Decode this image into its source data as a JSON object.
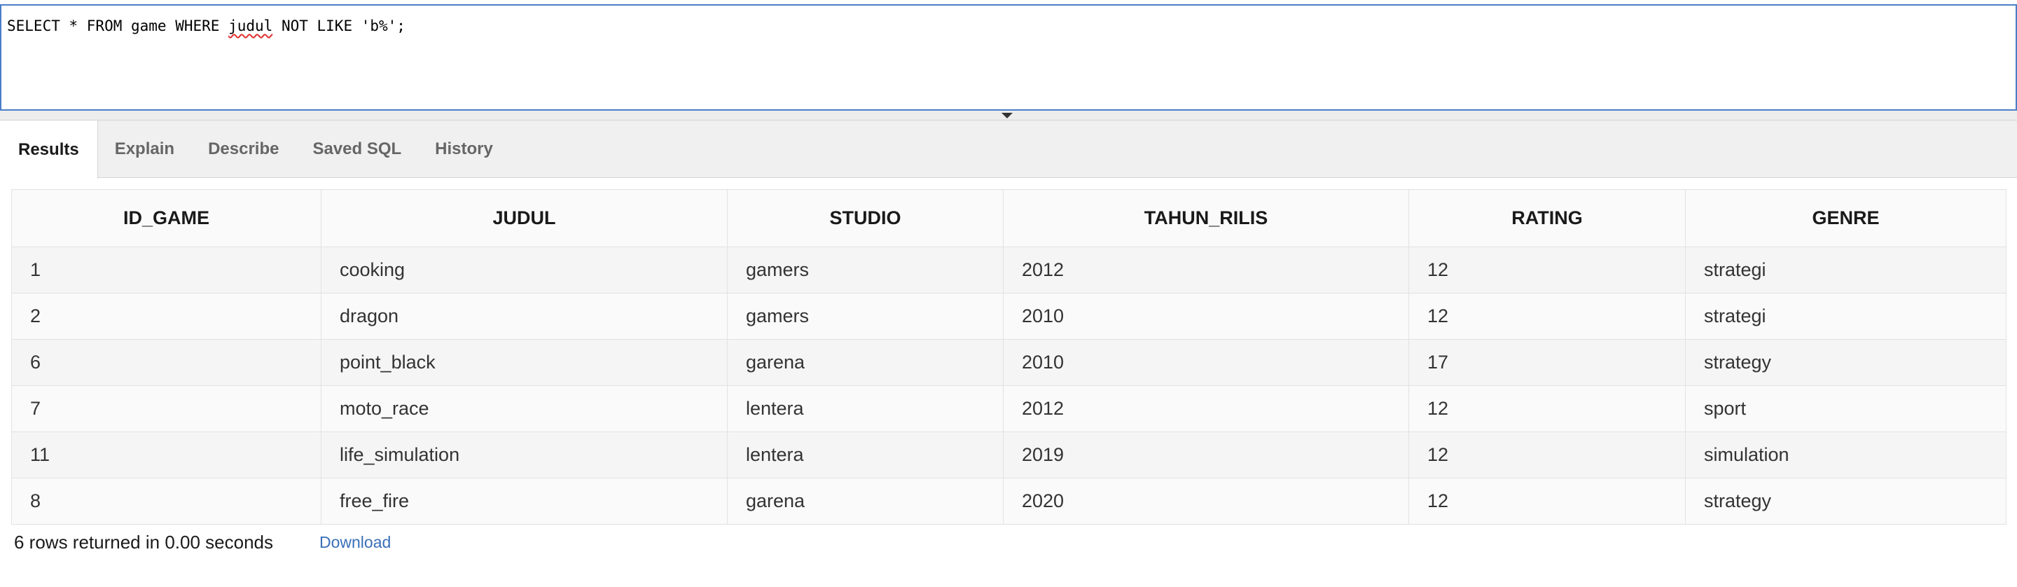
{
  "editor": {
    "sql_part1": "SELECT * FROM game WHERE ",
    "sql_misspelled": "judul",
    "sql_part2": " NOT LIKE 'b%';"
  },
  "tabs": [
    {
      "label": "Results",
      "active": true
    },
    {
      "label": "Explain",
      "active": false
    },
    {
      "label": "Describe",
      "active": false
    },
    {
      "label": "Saved SQL",
      "active": false
    },
    {
      "label": "History",
      "active": false
    }
  ],
  "table": {
    "columns": [
      "ID_GAME",
      "JUDUL",
      "STUDIO",
      "TAHUN_RILIS",
      "RATING",
      "GENRE"
    ],
    "rows": [
      [
        "1",
        "cooking",
        "gamers",
        "2012",
        "12",
        "strategi"
      ],
      [
        "2",
        "dragon",
        "gamers",
        "2010",
        "12",
        "strategi"
      ],
      [
        "6",
        "point_black",
        "garena",
        "2010",
        "17",
        "strategy"
      ],
      [
        "7",
        "moto_race",
        "lentera",
        "2012",
        "12",
        "sport"
      ],
      [
        "11",
        "life_simulation",
        "lentera",
        "2019",
        "12",
        "simulation"
      ],
      [
        "8",
        "free_fire",
        "garena",
        "2020",
        "12",
        "strategy"
      ]
    ]
  },
  "footer": {
    "row_count": "6 rows returned in 0.00 seconds",
    "download_label": "Download"
  },
  "colors": {
    "editor_border": "#4a7fc9",
    "link": "#3a6fb8",
    "spellcheck": "#e03030"
  }
}
